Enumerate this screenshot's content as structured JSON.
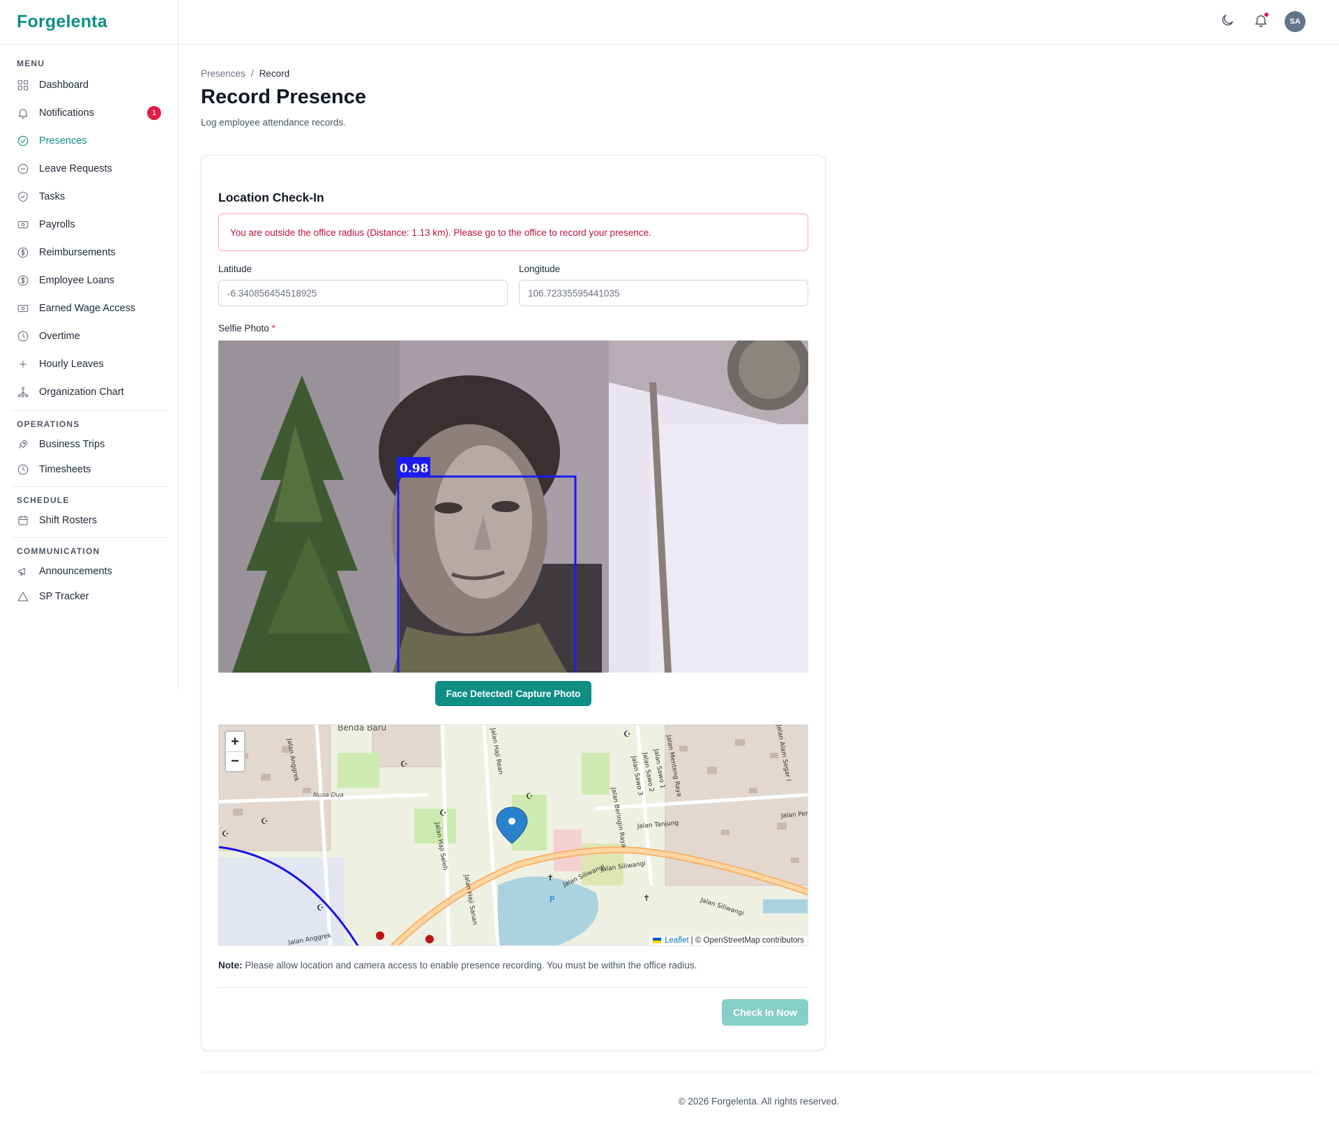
{
  "app": {
    "brand": "Forgelenta"
  },
  "sidebar": {
    "sections": {
      "menu": "MENU",
      "operations": "OPERATIONS",
      "schedule": "SCHEDULE",
      "communication": "COMMUNICATION"
    },
    "menu_items": [
      {
        "label": "Dashboard",
        "icon": "grid-icon"
      },
      {
        "label": "Notifications",
        "icon": "bell-icon",
        "badge": "1"
      },
      {
        "label": "Presences",
        "icon": "check-circle-icon",
        "active": true
      },
      {
        "label": "Leave Requests",
        "icon": "minus-circle-icon"
      },
      {
        "label": "Tasks",
        "icon": "shield-check-icon"
      },
      {
        "label": "Payrolls",
        "icon": "banknote-icon"
      },
      {
        "label": "Reimbursements",
        "icon": "dollar-circle-icon"
      },
      {
        "label": "Employee Loans",
        "icon": "dollar-circle-icon"
      },
      {
        "label": "Earned Wage Access",
        "icon": "banknote-icon"
      },
      {
        "label": "Overtime",
        "icon": "clock-icon"
      },
      {
        "label": "Hourly Leaves",
        "icon": "plus-icon"
      },
      {
        "label": "Organization Chart",
        "icon": "org-chart-icon"
      }
    ],
    "operations_items": [
      {
        "label": "Business Trips",
        "icon": "rocket-icon"
      },
      {
        "label": "Timesheets",
        "icon": "clock-icon"
      }
    ],
    "schedule_items": [
      {
        "label": "Shift Rosters",
        "icon": "calendar-icon"
      }
    ],
    "communication_items": [
      {
        "label": "Announcements",
        "icon": "megaphone-icon"
      },
      {
        "label": "SP Tracker",
        "icon": "warning-triangle-icon"
      }
    ]
  },
  "topbar": {
    "avatar_initials": "SA",
    "icons": [
      "moon-icon",
      "bell-icon"
    ]
  },
  "breadcrumb": {
    "parent": "Presences",
    "separator": "/",
    "current": "Record"
  },
  "page": {
    "title": "Record Presence",
    "subtitle": "Log employee attendance records."
  },
  "form": {
    "card_title": "Location Check-In",
    "alert": "You are outside the office radius (Distance: 1.13 km). Please go to the office to record your presence.",
    "latitude": {
      "label": "Latitude",
      "value": "-6.340856454518925"
    },
    "longitude": {
      "label": "Longitude",
      "value": "106.72335595441035"
    },
    "photo_label": "Selfie Photo",
    "required_mark": "*",
    "face_confidence": "0.98",
    "capture_button": "Face Detected! Capture Photo",
    "map": {
      "zoom_in": "+",
      "zoom_out": "−",
      "attribution_leaflet": "Leaflet",
      "attribution_osm": "| © OpenStreetMap contributors",
      "street_labels": [
        "Benda Baru",
        "Jalan Anggrek",
        "Nusa Dua",
        "Jalan Haji Saleh",
        "Jalan Haji Rean",
        "Jalan Haji Sanan",
        "Jalan Siliwangi",
        "Jalan Siliwangi",
        "Jalan Siliwangi",
        "Jalan Beringin Raya",
        "Jalan Tanjung",
        "Jalan Menteng Raya",
        "Jalan Perm",
        "Jalan Sawo 1",
        "Jalan Sawo 2",
        "Jalan Sawo 3",
        "Jalan Alam Segar I",
        "Jalan Anggrek"
      ]
    },
    "note_label": "Note:",
    "note_text": "Please allow location and camera access to enable presence recording. You must be within the office radius.",
    "checkin_button": "Check In Now"
  },
  "footer": {
    "text": "© 2026 Forgelenta. All rights reserved."
  },
  "colors": {
    "brand": "#0f8f84",
    "alert": "#be123c",
    "badge": "#e11d48",
    "disabled_button": "#86cfc7"
  }
}
